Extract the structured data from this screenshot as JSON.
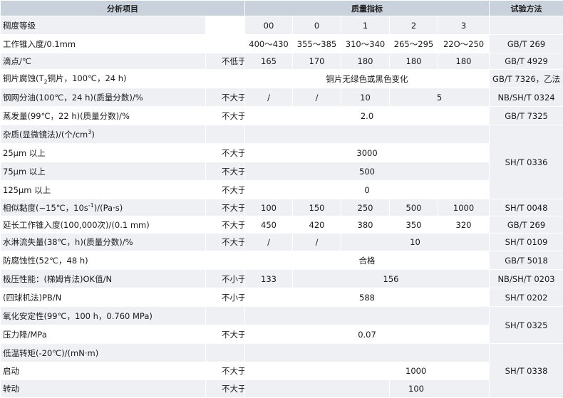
{
  "header": {
    "col_item": "分析项目",
    "col_spec": "质量指标",
    "col_method": "试验方法"
  },
  "rows": {
    "grade": {
      "label": "稠度等级",
      "v": [
        "00",
        "0",
        "1",
        "2",
        "3"
      ]
    },
    "penetration": {
      "label": "工作锥入度/0.1mm",
      "v": [
        "400～430",
        "355～385",
        "310～340",
        "265～295",
        "22O～250"
      ],
      "method": "GB/T 269"
    },
    "dropping": {
      "label": "滴点/℃",
      "qual": "不低于",
      "v": [
        "165",
        "170",
        "180",
        "180",
        "180"
      ],
      "method": "GB/T 4929"
    },
    "copper": {
      "label_a": "铜片腐蚀(T",
      "label_sub": "2",
      "label_b": "铜片，100℃，24 h)",
      "value": "铜片无绿色或黑色变化",
      "method": "GB/T 7326，乙法"
    },
    "oil_sep": {
      "label": "钢网分油(100℃，24 h)(质量分数)/%",
      "qual": "不大于",
      "v1": "/",
      "v2": "/",
      "v3": "10",
      "v45": "5",
      "method": "NB/SH/T 0324"
    },
    "evap": {
      "label": "蒸发量(99℃，22 h)(质量分数)/%",
      "qual": "不大于",
      "value": "2.0",
      "method": "GB/T 7325"
    },
    "impurity": {
      "label_a": "杂质(显微镜法)/(个/cm",
      "label_sup": "3",
      "label_b": ")",
      "method": "SH/T 0336"
    },
    "imp25": {
      "label": "25μm 以上",
      "qual": "不大于",
      "value": "3000"
    },
    "imp75": {
      "label": "75μm 以上",
      "qual": "不大于",
      "value": "500"
    },
    "imp125": {
      "label": "125μm 以上",
      "qual": "不大于",
      "value": "0"
    },
    "viscosity": {
      "label_a": "相似黏度(−15℃，10s",
      "label_sup": "-1",
      "label_b": ")/(Pa·s)",
      "qual": "不大于",
      "v": [
        "100",
        "150",
        "250",
        "500",
        "1000"
      ],
      "method": "SH/T 0048"
    },
    "ext_pen": {
      "label": "延长工作锥入度(100,000次)/(0.1 mm)",
      "qual": "不大于",
      "v": [
        "450",
        "420",
        "380",
        "350",
        "320"
      ],
      "method": "GB/T 269"
    },
    "washout": {
      "label": "水淋流失量(38℃，h)(质量分数)/%",
      "qual": "不大于",
      "v1": "/",
      "v2": "/",
      "v345": "10",
      "method": "SH/T 0109"
    },
    "rust": {
      "label": "防腐蚀性(52℃，48 h)",
      "value": "合格",
      "method": "GB/T 5018"
    },
    "ep_ok": {
      "label": "极压性能：(梯姆肯法)OK值/N",
      "qual": "不小于",
      "v1": "133",
      "v2345": "156",
      "method": "NB/SH/T 0203"
    },
    "ep_pb": {
      "label": "(四球机法)PB/N",
      "qual": "不小于",
      "value": "588",
      "method": "SH/T 0202"
    },
    "oxid": {
      "label": "氧化安定性(99℃，100 h，0.760 MPa)",
      "method": "SH/T 0325"
    },
    "pdrop": {
      "label": "压力降/MPa",
      "qual": "不大于",
      "value": "0.07"
    },
    "torque": {
      "label": "低温转矩(-20℃)/(mN·m)",
      "method": "SH/T 0338"
    },
    "start": {
      "label": "启动",
      "qual": "不大于",
      "value": "1000"
    },
    "run": {
      "label": "转动",
      "qual": "不大于",
      "value": "100"
    }
  }
}
